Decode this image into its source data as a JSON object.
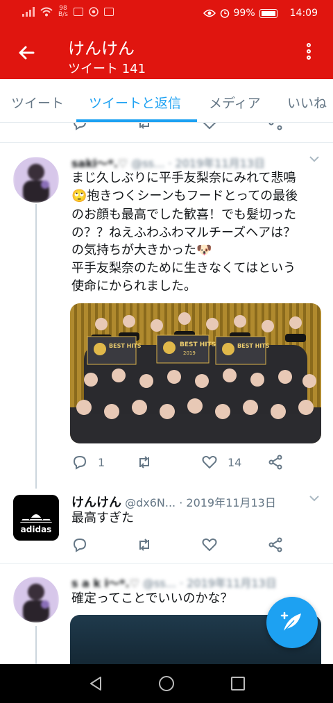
{
  "status_bar": {
    "network_speed_value": "98",
    "network_speed_unit": "B/s",
    "battery": "99%",
    "time": "14:09"
  },
  "header": {
    "title": "けんけん",
    "subtitle": "ツイート 141"
  },
  "tabs": [
    {
      "label": "ツイート"
    },
    {
      "label": "ツイートと返信"
    },
    {
      "label": "メディア"
    },
    {
      "label": "いいね"
    }
  ],
  "tweets": [
    {
      "name": "saki〜*.♡",
      "handle": "@ss...",
      "date": "· 2019年11月13日",
      "lines": [
        "まじ久しぶりに平手友梨奈にみれて悲鳴",
        "🙄抱きつくシーンもフードとっての最後",
        "のお顔も最高でした歓喜！でも髪切った",
        "の？？ねえふわふわマルチーズヘアは？",
        "の気持ちが大きかった🐶",
        "平手友梨奈のために生きなくてはという",
        "使命にかられました。"
      ],
      "photo_banner": "BEST HITS",
      "photo_year": "2019",
      "reply_count": "1",
      "retweet_count": "",
      "like_count": "14"
    },
    {
      "name": "けんけん",
      "handle": "@dx6N...",
      "date": "· 2019年11月13日",
      "avatar_text": "adidas",
      "lines": [
        "最高すぎた"
      ],
      "reply_count": "",
      "retweet_count": "",
      "like_count": ""
    },
    {
      "name": "s a k i〜*.♡",
      "handle": "@ss...",
      "date": "· 2019年11月13日",
      "lines": [
        "確定ってことでいいのかな？"
      ]
    }
  ],
  "colors": {
    "header": "#e0150f",
    "accent": "#1da1f2",
    "muted": "#657786",
    "text": "#14171a"
  }
}
